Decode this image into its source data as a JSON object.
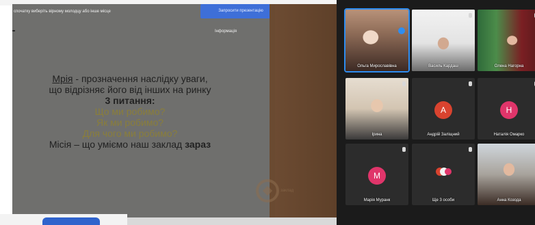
{
  "share": {
    "hint": "спочатку виберіть вірному молодцу або інше місце",
    "present_button": "Запросити презентацію",
    "info_link": "Інформація",
    "slide": {
      "line1_term": "Мрія",
      "line1_rest": " - прозначення наслідку уваги,",
      "line2": "що відрізняє його від інших на ринку",
      "line3": "3 питання:",
      "line4": "Що ми робимо?",
      "line5": "Як ми робимо?",
      "line6": "Для чого ми робимо?",
      "line7_pre": "Місія – що уміємо наш заклад ",
      "line7_bold": "зараз"
    },
    "logo_text": "заклад"
  },
  "gallery": {
    "tiles": [
      {
        "name": "Ольга Мирославівна",
        "kind": "video"
      },
      {
        "name": "Василь Кардаш",
        "kind": "video"
      },
      {
        "name": "Олена Нагорна",
        "kind": "video"
      },
      {
        "name": "Ірина",
        "kind": "video"
      },
      {
        "name": "Андрій Заліщний",
        "kind": "avatar",
        "initial": "A",
        "color": "#d9432f"
      },
      {
        "name": "Наталія Омарко",
        "kind": "avatar",
        "initial": "H",
        "color": "#e0356a"
      },
      {
        "name": "Марія Муранк",
        "kind": "avatar",
        "initial": "M",
        "color": "#e0356a"
      },
      {
        "name": "Ще 3 особи",
        "kind": "group"
      },
      {
        "name": "Анна Козода",
        "kind": "video"
      }
    ]
  }
}
